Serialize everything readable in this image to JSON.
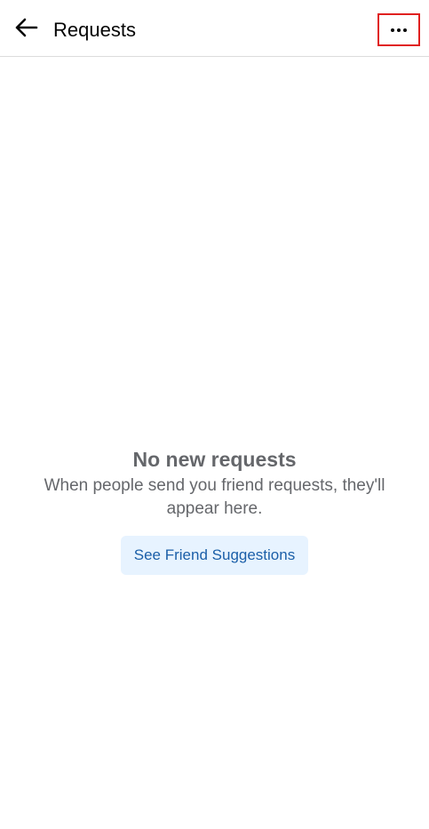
{
  "header": {
    "back_icon": "arrow-left-icon",
    "title": "Requests",
    "more_icon": "more-horizontal-icon",
    "more_highlight_color": "#e0201f"
  },
  "empty_state": {
    "title": "No new requests",
    "description": "When people send you friend requests, they'll appear here.",
    "button_label": "See Friend Suggestions",
    "button_bg": "#e7f3ff",
    "button_color": "#1b5fa8"
  }
}
